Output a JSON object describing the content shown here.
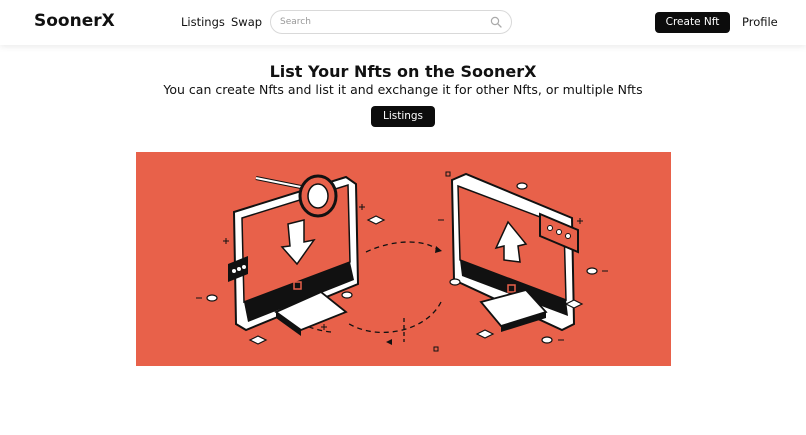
{
  "header": {
    "brand": "SoonerX",
    "nav": [
      {
        "label": "Listings"
      },
      {
        "label": "Swap"
      }
    ],
    "search": {
      "placeholder": "Search",
      "value": "",
      "icon": "search-icon"
    },
    "create_button": "Create Nft",
    "profile_link": "Profile"
  },
  "hero": {
    "title": "List Your Nfts on the SoonerX",
    "subtitle": "You can create Nfts and list it and exchange it for other Nfts, or multiple Nfts",
    "button": "Listings"
  },
  "illustration": {
    "name": "nft-exchange-illustration",
    "background_color": "#e8614a"
  }
}
